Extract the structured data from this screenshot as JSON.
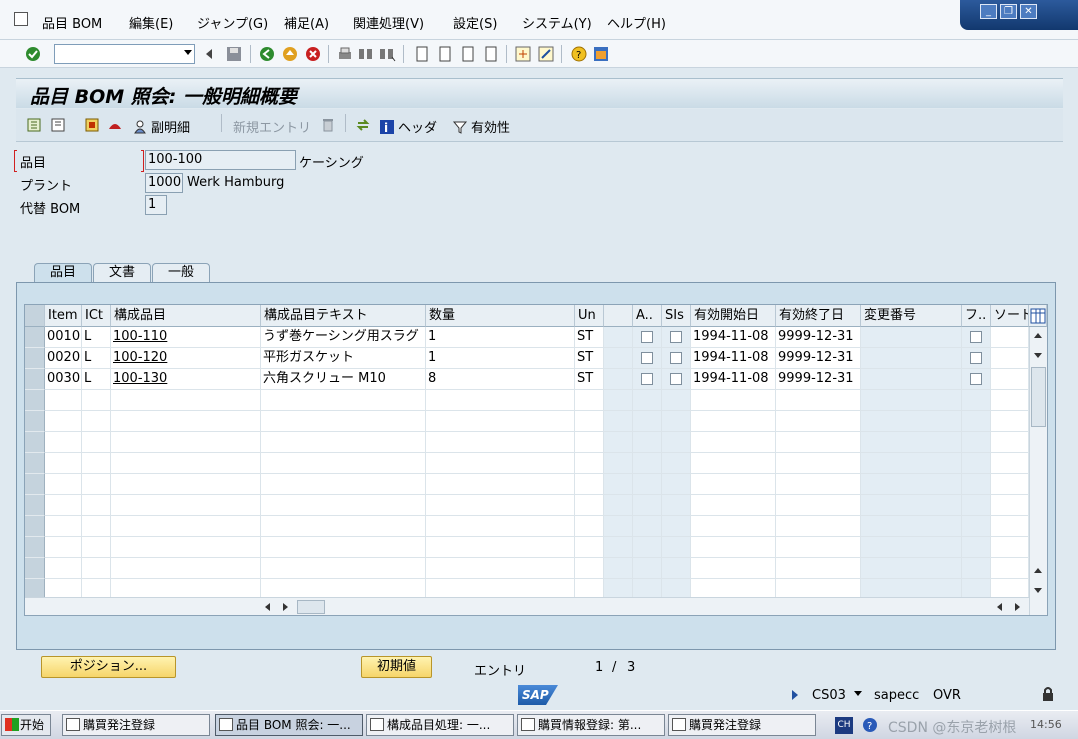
{
  "menu": {
    "items": [
      "品目 BOM",
      "編集(E)",
      "ジャンプ(G)",
      "補足(A)",
      "関連処理(V)",
      "設定(S)",
      "システム(Y)",
      "ヘルプ(H)"
    ]
  },
  "screen": {
    "title": "品目 BOM 照会: 一般明細概要"
  },
  "app_toolbar": {
    "sub_item": "副明細",
    "new_entry": "新規エントリ",
    "header": "ヘッダ",
    "validity": "有効性"
  },
  "header_fields": {
    "material_label": "品目",
    "material_value": "100-100",
    "material_desc": "ケーシング",
    "plant_label": "プラント",
    "plant_value": "1000",
    "plant_desc": "Werk Hamburg",
    "alt_bom_label": "代替 BOM",
    "alt_bom_value": "1"
  },
  "tabs": [
    "品目",
    "文書",
    "一般"
  ],
  "grid": {
    "columns": [
      "Item",
      "ICt",
      "構成品目",
      "構成品目テキスト",
      "数量",
      "Un",
      "",
      "A..",
      "SIs",
      "有効開始日",
      "有効終了日",
      "変更番号",
      "フ..",
      "ソート..."
    ],
    "rows": [
      {
        "item": "0010",
        "ict": "L",
        "component": "100-110",
        "text": "うず巻ケーシング用スラグ",
        "qty": "1",
        "un": "ST",
        "from": "1994-11-08",
        "to": "9999-12-31"
      },
      {
        "item": "0020",
        "ict": "L",
        "component": "100-120",
        "text": "平形ガスケット",
        "qty": "1",
        "un": "ST",
        "from": "1994-11-08",
        "to": "9999-12-31"
      },
      {
        "item": "0030",
        "ict": "L",
        "component": "100-130",
        "text": "六角スクリュー M10",
        "qty": "8",
        "un": "ST",
        "from": "1994-11-08",
        "to": "9999-12-31"
      }
    ]
  },
  "bottom": {
    "position_button": "ポジション...",
    "initial_button": "初期値",
    "entry_label": "エントリ",
    "entry_current": "1",
    "entry_sep": "/",
    "entry_total": "3"
  },
  "status": {
    "sap_logo": "SAP",
    "transaction": "CS03",
    "server": "sapecc",
    "mode": "OVR"
  },
  "taskbar": {
    "start": "开始",
    "tasks": [
      "購買発注登録",
      "品目 BOM 照会: 一...",
      "構成品目処理: 一...",
      "購買情報登録: 第...",
      "購買発注登録"
    ],
    "ime": "CH",
    "watermark": "CSDN @东京老树根",
    "clock": "14:56"
  },
  "colors": {
    "accent": "#2c5a9c",
    "button_yellow": "#f6d56a",
    "panel": "#cde0ec"
  }
}
